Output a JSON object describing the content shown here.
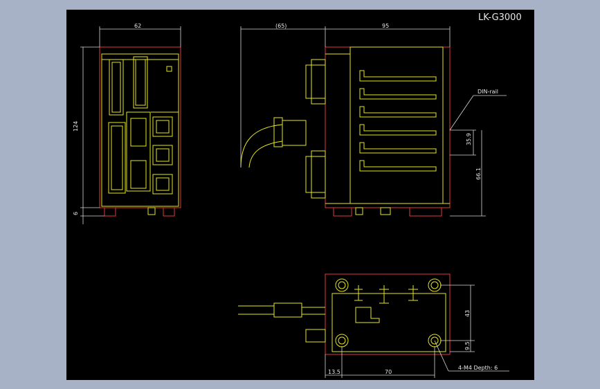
{
  "drawing": {
    "title": "LK-G3000",
    "front_view": {
      "dims": {
        "width": "62",
        "height": "124",
        "foot": "6"
      }
    },
    "side_view": {
      "dims": {
        "cable_len": "(65)",
        "depth": "95",
        "rail_h1": "35.9",
        "rail_h2": "66.1"
      },
      "callout": "DIN-rail"
    },
    "bottom_view": {
      "dims": {
        "edge": "13.5",
        "pitch_x": "70",
        "pitch_y": "43",
        "edge_y": "9.5"
      },
      "callout": "4-M4  Depth: 6"
    }
  },
  "colors": {
    "background": "#000000",
    "frame": "#a8b2c6",
    "outline": "#e6e61e",
    "hidden": "#e03a3a",
    "dimension": "#d8d8d8"
  }
}
